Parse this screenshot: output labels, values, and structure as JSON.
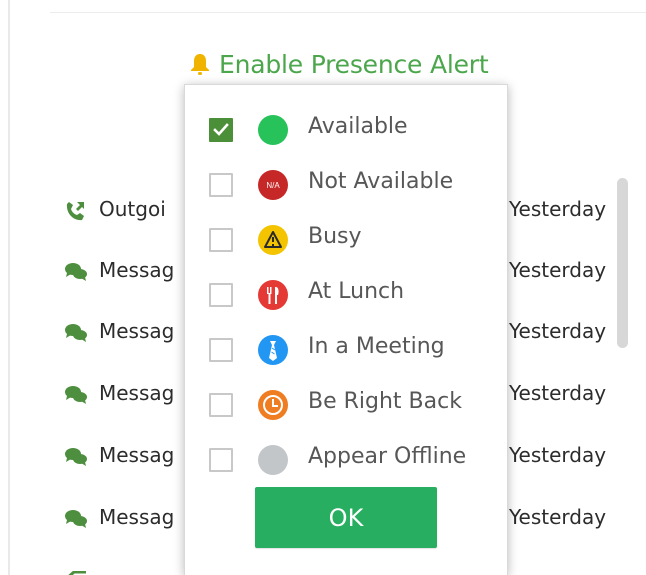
{
  "presence_alert": {
    "label": "Enable Presence Alert",
    "icon": "bell-icon",
    "color": "#4ba64c"
  },
  "activity_list": {
    "rows": [
      {
        "type": "call-outgoing-icon",
        "label": "Outgoi",
        "time": "Yesterday"
      },
      {
        "type": "message-icon",
        "label": "Messag",
        "time": "Yesterday"
      },
      {
        "type": "message-icon",
        "label": "Messag",
        "time": "Yesterday"
      },
      {
        "type": "message-icon",
        "label": "Messag",
        "time": "Yesterday"
      },
      {
        "type": "message-icon",
        "label": "Messag",
        "time": "Yesterday"
      },
      {
        "type": "message-icon",
        "label": "Messag",
        "time": "Yesterday"
      }
    ]
  },
  "status_dropdown": {
    "options": [
      {
        "label": "Available",
        "checked": true,
        "icon": "available-status-icon",
        "color": "#27c35a"
      },
      {
        "label": "Not Available",
        "checked": false,
        "icon": "not-available-status-icon",
        "color": "#c62828",
        "icon_text": "N/A"
      },
      {
        "label": "Busy",
        "checked": false,
        "icon": "busy-warning-icon",
        "color": "#f4c400"
      },
      {
        "label": "At Lunch",
        "checked": false,
        "icon": "lunch-fork-knife-icon",
        "color": "#e53935"
      },
      {
        "label": "In a Meeting",
        "checked": false,
        "icon": "meeting-tie-icon",
        "color": "#2196f3"
      },
      {
        "label": "Be Right Back",
        "checked": false,
        "icon": "be-right-back-clock-icon",
        "color": "#ef7d22"
      },
      {
        "label": "Appear Offline",
        "checked": false,
        "icon": "offline-status-icon",
        "color": "#c3c6c9"
      }
    ],
    "ok_label": "OK",
    "ok_color": "#27ae60"
  }
}
